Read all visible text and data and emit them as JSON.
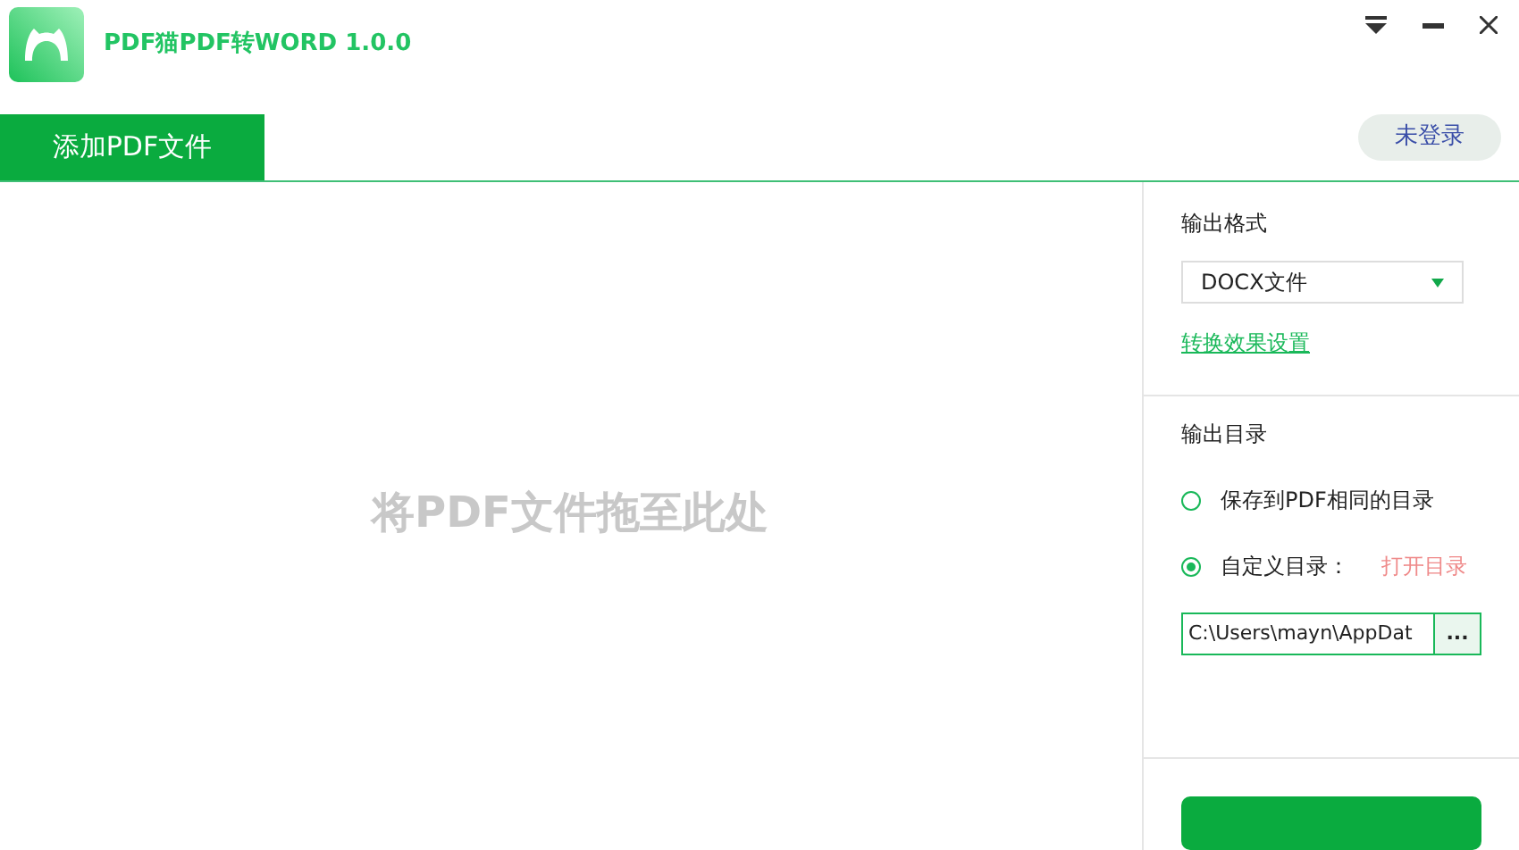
{
  "window": {
    "title": "PDF猫PDF转WORD 1.0.0"
  },
  "tabs": [
    {
      "label": "添加PDF文件",
      "selected": true
    }
  ],
  "login_button": "未登录",
  "drop_zone": {
    "hint": "将PDF文件拖至此处"
  },
  "output_format": {
    "label": "输出格式",
    "value": "DOCX文件",
    "settings_link": "转换效果设置"
  },
  "output_directory": {
    "label": "输出目录",
    "options": [
      {
        "label": "保存到PDF相同的目录",
        "selected": false
      },
      {
        "label": "自定义目录：",
        "selected": true
      }
    ],
    "open_link": "打开目录",
    "path": "C:\\Users\\mayn\\AppDat",
    "browse": "..."
  }
}
